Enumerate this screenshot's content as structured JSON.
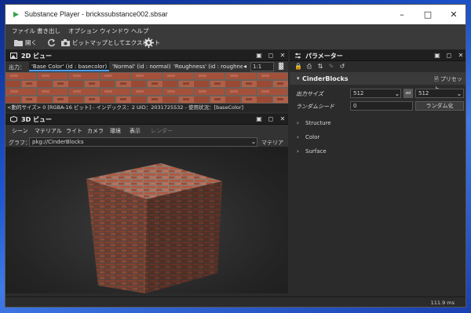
{
  "window": {
    "title": "Substance Player - brickssubstance002.sbsar",
    "minimize_icon": "minimize-icon",
    "maximize_icon": "maximize-icon",
    "close_icon": "close-icon"
  },
  "menu": {
    "items": [
      "ファイル",
      "書き出し",
      "オプション",
      "ウィンドウ",
      "ヘルプ"
    ]
  },
  "toolbar": {
    "open_label": "開く",
    "export_label": "ビットマップとしてエクスポート"
  },
  "view2d": {
    "title": "2D ビュー",
    "output_label": "出力：",
    "tabs": [
      "'Base Color' (id : basecolor)",
      "'Normal' (id : normal)",
      "'Roughness' (id : roughne"
    ],
    "zoom": "1:1",
    "status": "<動的サイズ> 0 [RGBA-16 ビット] - インデックス：2 UID：2031725532 - 使用状況：[baseColor]"
  },
  "view3d": {
    "title": "3D ビュー",
    "menu": [
      "シーン",
      "マテリアル",
      "ライト",
      "カメラ",
      "環境",
      "表示",
      "レンダー"
    ],
    "graph_label": "グラフ：",
    "graph_value": "pkg://CinderBlocks",
    "material_label": "マテリアル"
  },
  "params": {
    "title": "パラメーター",
    "package": "CinderBlocks",
    "preset_label": "プリセット",
    "output_size_label": "出力サイズ",
    "output_size_w": "512",
    "output_size_h": "512",
    "link_label": "ød",
    "random_seed_label": "ランダムシード",
    "random_seed_value": "0",
    "randomize_label": "ランダム化",
    "sections": [
      "Structure",
      "Color",
      "Surface"
    ]
  },
  "status": {
    "time": "111.9 ms"
  },
  "colors": {
    "accent": "#4aa0ff",
    "panel_bg": "#2b2b2b",
    "header_bg": "#1f1f1f"
  }
}
